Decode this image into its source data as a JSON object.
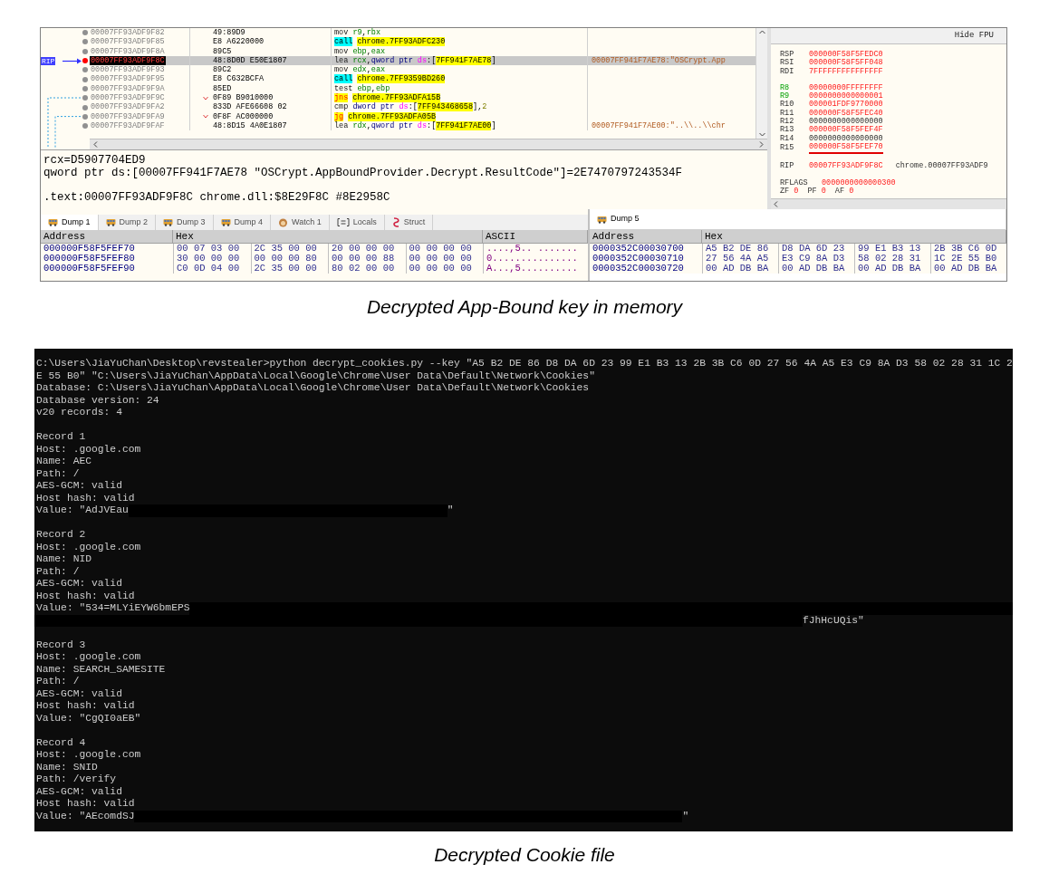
{
  "figures": [
    {
      "caption": "Decrypted App-Bound key in memory"
    },
    {
      "caption": "Decrypted Cookie file"
    }
  ],
  "debugger": {
    "disassembly": [
      {
        "address": "00007FF93ADF9F82",
        "bytes": "49:89D9",
        "selected": false,
        "rip": false,
        "jump": false,
        "instruction": [
          {
            "text": "mov ",
            "kind": "mnem"
          },
          {
            "text": "r9",
            "kind": "reg"
          },
          {
            "text": ",",
            "kind": "plain"
          },
          {
            "text": "rbx",
            "kind": "reg"
          }
        ]
      },
      {
        "address": "00007FF93ADF9F85",
        "bytes": "E8 A6220000",
        "selected": false,
        "rip": false,
        "jump": false,
        "instruction": [
          {
            "text": "call",
            "kind": "call"
          },
          {
            "text": "chrome.7FF93ADFC230",
            "kind": "target"
          }
        ]
      },
      {
        "address": "00007FF93ADF9F8A",
        "bytes": "89C5",
        "selected": false,
        "rip": false,
        "jump": false,
        "instruction": [
          {
            "text": "mov ",
            "kind": "mnem"
          },
          {
            "text": "ebp",
            "kind": "reg"
          },
          {
            "text": ",",
            "kind": "plain"
          },
          {
            "text": "eax",
            "kind": "reg"
          }
        ]
      },
      {
        "address": "00007FF93ADF9F8C",
        "bytes": "48:8D0D E50E1807",
        "selected": true,
        "rip": true,
        "rip_label": "RIP",
        "jump": false,
        "instruction": [
          {
            "text": "lea ",
            "kind": "mnem"
          },
          {
            "text": "rcx",
            "kind": "reg"
          },
          {
            "text": ",",
            "kind": "plain"
          },
          {
            "text": "qword ptr ",
            "kind": "size"
          },
          {
            "text": "ds",
            "kind": "seg"
          },
          {
            "text": ":[",
            "kind": "plain"
          },
          {
            "text": "7FF941F7AE78",
            "kind": "target"
          },
          {
            "text": "]",
            "kind": "plain"
          }
        ],
        "comment": "00007FF941F7AE78:\"OSCrypt.App"
      },
      {
        "address": "00007FF93ADF9F93",
        "bytes": "89C2",
        "selected": false,
        "rip": false,
        "jump": false,
        "instruction": [
          {
            "text": "mov ",
            "kind": "mnem"
          },
          {
            "text": "edx",
            "kind": "reg"
          },
          {
            "text": ",",
            "kind": "plain"
          },
          {
            "text": "eax",
            "kind": "reg"
          }
        ]
      },
      {
        "address": "00007FF93ADF9F95",
        "bytes": "E8 C632BCFA",
        "selected": false,
        "rip": false,
        "jump": false,
        "instruction": [
          {
            "text": "call",
            "kind": "call"
          },
          {
            "text": "chrome.7FF9359BD260",
            "kind": "target"
          }
        ]
      },
      {
        "address": "00007FF93ADF9F9A",
        "bytes": "85ED",
        "selected": false,
        "rip": false,
        "jump": false,
        "instruction": [
          {
            "text": "test ",
            "kind": "mnem"
          },
          {
            "text": "ebp",
            "kind": "reg"
          },
          {
            "text": ",",
            "kind": "plain"
          },
          {
            "text": "ebp",
            "kind": "reg"
          }
        ]
      },
      {
        "address": "00007FF93ADF9F9C",
        "bytes": "0F89 B9010000",
        "selected": false,
        "rip": false,
        "jump": true,
        "instruction": [
          {
            "text": "jns",
            "kind": "jump"
          },
          {
            "text": "chrome.7FF93ADFA15B",
            "kind": "target"
          }
        ]
      },
      {
        "address": "00007FF93ADF9FA2",
        "bytes": "833D AFE66608 02",
        "selected": false,
        "rip": false,
        "jump": false,
        "instruction": [
          {
            "text": "cmp ",
            "kind": "mnem"
          },
          {
            "text": "dword ptr ",
            "kind": "size"
          },
          {
            "text": "ds",
            "kind": "seg"
          },
          {
            "text": ":[",
            "kind": "plain"
          },
          {
            "text": "7FF943468658",
            "kind": "target"
          },
          {
            "text": "],",
            "kind": "plain"
          },
          {
            "text": "2",
            "kind": "num"
          }
        ]
      },
      {
        "address": "00007FF93ADF9FA9",
        "bytes": "0F8F AC000000",
        "selected": false,
        "rip": false,
        "jump": true,
        "instruction": [
          {
            "text": "jg",
            "kind": "jump"
          },
          {
            "text": "chrome.7FF93ADFA05B",
            "kind": "target"
          }
        ]
      },
      {
        "address": "00007FF93ADF9FAF",
        "bytes": "48:8D15 4A0E1807",
        "selected": false,
        "rip": false,
        "jump": false,
        "instruction": [
          {
            "text": "lea ",
            "kind": "mnem"
          },
          {
            "text": "rdx",
            "kind": "reg"
          },
          {
            "text": ",",
            "kind": "plain"
          },
          {
            "text": "qword ptr ",
            "kind": "size"
          },
          {
            "text": "ds",
            "kind": "seg"
          },
          {
            "text": ":[",
            "kind": "plain"
          },
          {
            "text": "7FF941F7AE00",
            "kind": "target"
          },
          {
            "text": "]",
            "kind": "plain"
          }
        ],
        "comment": "00007FF941F7AE00:\"..\\\\..\\\\chr"
      }
    ],
    "registers": {
      "hide_fpu": "Hide FPU",
      "groups": [
        [
          {
            "name": "RSP",
            "value": "000000F58F5FEDC0",
            "name_changed": false,
            "value_changed": true,
            "underlined": false
          },
          {
            "name": "RSI",
            "value": "000000F58F5FF048",
            "name_changed": false,
            "value_changed": true,
            "underlined": false
          },
          {
            "name": "RDI",
            "value": "7FFFFFFFFFFFFFFF",
            "name_changed": false,
            "value_changed": true,
            "underlined": false
          }
        ],
        [
          {
            "name": "R8",
            "value": "00000000FFFFFFFF",
            "name_changed": true,
            "value_changed": true,
            "underlined": false
          },
          {
            "name": "R9",
            "value": "0000000000000001",
            "name_changed": true,
            "value_changed": true,
            "underlined": false
          },
          {
            "name": "R10",
            "value": "000001FDF9770000",
            "name_changed": false,
            "value_changed": true,
            "underlined": false
          },
          {
            "name": "R11",
            "value": "000000F58F5FEC40",
            "name_changed": false,
            "value_changed": true,
            "underlined": false
          },
          {
            "name": "R12",
            "value": "0000000000000000",
            "name_changed": false,
            "value_changed": false,
            "underlined": false
          },
          {
            "name": "R13",
            "value": "000000F58F5FEF4F",
            "name_changed": false,
            "value_changed": true,
            "underlined": false
          },
          {
            "name": "R14",
            "value": "0000000000000000",
            "name_changed": false,
            "value_changed": false,
            "underlined": false
          },
          {
            "name": "R15",
            "value": "000000F58F5FEF70",
            "name_changed": false,
            "value_changed": true,
            "underlined": true
          }
        ],
        [
          {
            "name": "RIP",
            "value": "00007FF93ADF9F8C",
            "name_changed": false,
            "value_changed": true,
            "underlined": false,
            "comment": "chrome.00007FF93ADF9"
          }
        ],
        [
          {
            "name": "RFLAGS",
            "value": "0000000000000300",
            "name_changed": false,
            "value_changed": true,
            "underlined": false
          }
        ]
      ],
      "flags": [
        {
          "name": "ZF",
          "value": "0"
        },
        {
          "name": "PF",
          "value": "0"
        },
        {
          "name": "AF",
          "value": "0"
        }
      ]
    },
    "info_lines": [
      "rcx=D5907704ED9",
      "qword ptr ds:[00007FF941F7AE78 \"OSCrypt.AppBoundProvider.Decrypt.ResultCode\"]=2E7470797243534F",
      ".text:00007FF93ADF9F8C chrome.dll:$8E29F8C #8E2958C"
    ],
    "tabs": [
      {
        "label": "Dump 1",
        "kind": "dump",
        "selected": true
      },
      {
        "label": "Dump 2",
        "kind": "dump",
        "selected": false
      },
      {
        "label": "Dump 3",
        "kind": "dump",
        "selected": false
      },
      {
        "label": "Dump 4",
        "kind": "dump",
        "selected": false
      },
      {
        "label": "Watch 1",
        "kind": "watch",
        "selected": false
      },
      {
        "label": "Locals",
        "kind": "locals",
        "selected": false
      },
      {
        "label": "Struct",
        "kind": "struct",
        "selected": false
      }
    ],
    "dump1": {
      "columns": [
        "Address",
        "Hex",
        "ASCII"
      ],
      "rows": [
        {
          "address": "000000F58F5FEF70",
          "underlined": false,
          "groups": [
            {
              "text": "00 07 03 00",
              "underlined": true
            },
            {
              "text": "2C 35 00 00",
              "underlined": true
            },
            {
              "text": "20 00 00 00",
              "underlined": false
            },
            {
              "text": "00 00 00 00",
              "underlined": false
            }
          ],
          "ascii": "....,5.. ......."
        },
        {
          "address": "000000F58F5FEF80",
          "underlined": false,
          "groups": [
            {
              "text": "30 00 00 00",
              "underlined": false
            },
            {
              "text": "00 00 00 80",
              "underlined": false
            },
            {
              "text": "00 00 00 88",
              "underlined": false
            },
            {
              "text": "00 00 00 00",
              "underlined": false
            }
          ],
          "ascii": "0..............."
        },
        {
          "address": "000000F58F5FEF90",
          "underlined": false,
          "groups": [
            {
              "text": "C0 0D 04 00",
              "underlined": false
            },
            {
              "text": "2C 35 00 00",
              "underlined": false
            },
            {
              "text": "80 02 00 00",
              "underlined": false
            },
            {
              "text": "00 00 00 00",
              "underlined": false
            }
          ],
          "ascii": "À...,5.........."
        }
      ]
    },
    "dump5": {
      "tab": {
        "label": "Dump 5",
        "kind": "dump",
        "selected": true
      },
      "columns": [
        "Address",
        "Hex"
      ],
      "rows": [
        {
          "address": "0000352C00030700",
          "underlined": true,
          "groups": [
            {
              "text": "A5 B2 DE 86",
              "underlined": false
            },
            {
              "text": "D8 DA 6D 23",
              "underlined": false
            },
            {
              "text": "99 E1 B3 13",
              "underlined": false
            },
            {
              "text": "2B 3B C6 0D",
              "underlined": false
            }
          ]
        },
        {
          "address": "0000352C00030710",
          "underlined": false,
          "groups": [
            {
              "text": "27 56 4A A5",
              "underlined": false
            },
            {
              "text": "E3 C9 8A D3",
              "underlined": false
            },
            {
              "text": "58 02 28 31",
              "underlined": false
            },
            {
              "text": "1C 2E 55 B0",
              "underlined": false
            }
          ]
        },
        {
          "address": "0000352C00030720",
          "underlined": false,
          "groups": [
            {
              "text": "00 AD DB BA",
              "underlined": false
            },
            {
              "text": "00 AD DB BA",
              "underlined": false
            },
            {
              "text": "00 AD DB BA",
              "underlined": false
            },
            {
              "text": "00 AD DB BA",
              "underlined": false
            }
          ]
        }
      ]
    }
  },
  "terminal": {
    "header_lines": [
      "C:\\Users\\JiaYuChan\\Desktop\\revstealer>python decrypt_cookies.py --key \"A5 B2 DE 86 D8 DA 6D 23 99 E1 B3 13 2B 3B C6 0D 27 56 4A A5 E3 C9 8A D3 58 02 28 31 1C 2",
      "E 55 B0\" \"C:\\Users\\JiaYuChan\\AppData\\Local\\Google\\Chrome\\User Data\\Default\\Network\\Cookies\"",
      "Database: C:\\Users\\JiaYuChan\\AppData\\Local\\Google\\Chrome\\User Data\\Default\\Network\\Cookies",
      "Database version: 24",
      "v20 records: 4"
    ],
    "records": [
      {
        "lines": [
          [
            {
              "kind": "text",
              "text": "Record 1"
            }
          ],
          [
            {
              "kind": "text",
              "text": "Host: .google.com"
            }
          ],
          [
            {
              "kind": "text",
              "text": "Name: AEC"
            }
          ],
          [
            {
              "kind": "text",
              "text": "Path: /"
            }
          ],
          [
            {
              "kind": "text",
              "text": "AES-GCM: valid"
            }
          ],
          [
            {
              "kind": "text",
              "text": "Host hash: valid"
            }
          ],
          [
            {
              "kind": "text",
              "text": "Value: \"AdJVEau"
            },
            {
              "kind": "shortmask"
            },
            {
              "kind": "text",
              "text": "\""
            }
          ]
        ]
      },
      {
        "lines": [
          [
            {
              "kind": "text",
              "text": "Record 2"
            }
          ],
          [
            {
              "kind": "text",
              "text": "Host: .google.com"
            }
          ],
          [
            {
              "kind": "text",
              "text": "Name: NID"
            }
          ],
          [
            {
              "kind": "text",
              "text": "Path: /"
            }
          ],
          [
            {
              "kind": "text",
              "text": "AES-GCM: valid"
            }
          ],
          [
            {
              "kind": "text",
              "text": "Host hash: valid"
            }
          ],
          [
            {
              "kind": "text",
              "text": "Value: \"534=MLYiEYW6bmEPS"
            },
            {
              "kind": "fillmask"
            }
          ],
          [
            {
              "kind": "longmask"
            },
            {
              "kind": "text",
              "text": "fJhHcUQis\""
            }
          ]
        ]
      },
      {
        "lines": [
          [
            {
              "kind": "text",
              "text": "Record 3"
            }
          ],
          [
            {
              "kind": "text",
              "text": "Host: .google.com"
            }
          ],
          [
            {
              "kind": "text",
              "text": "Name: SEARCH_SAMESITE"
            }
          ],
          [
            {
              "kind": "text",
              "text": "Path: /"
            }
          ],
          [
            {
              "kind": "text",
              "text": "AES-GCM: valid"
            }
          ],
          [
            {
              "kind": "text",
              "text": "Host hash: valid"
            }
          ],
          [
            {
              "kind": "text",
              "text": "Value: \"CgQI0aEB\""
            }
          ]
        ]
      },
      {
        "lines": [
          [
            {
              "kind": "text",
              "text": "Record 4"
            }
          ],
          [
            {
              "kind": "text",
              "text": "Host: .google.com"
            }
          ],
          [
            {
              "kind": "text",
              "text": "Name: SNID"
            }
          ],
          [
            {
              "kind": "text",
              "text": "Path: /verify"
            }
          ],
          [
            {
              "kind": "text",
              "text": "AES-GCM: valid"
            }
          ],
          [
            {
              "kind": "text",
              "text": "Host hash: valid"
            }
          ],
          [
            {
              "kind": "text",
              "text": "Value: \"AEcomdSJ"
            },
            {
              "kind": "mediummask"
            },
            {
              "kind": "text",
              "text": "\""
            }
          ]
        ]
      }
    ]
  }
}
